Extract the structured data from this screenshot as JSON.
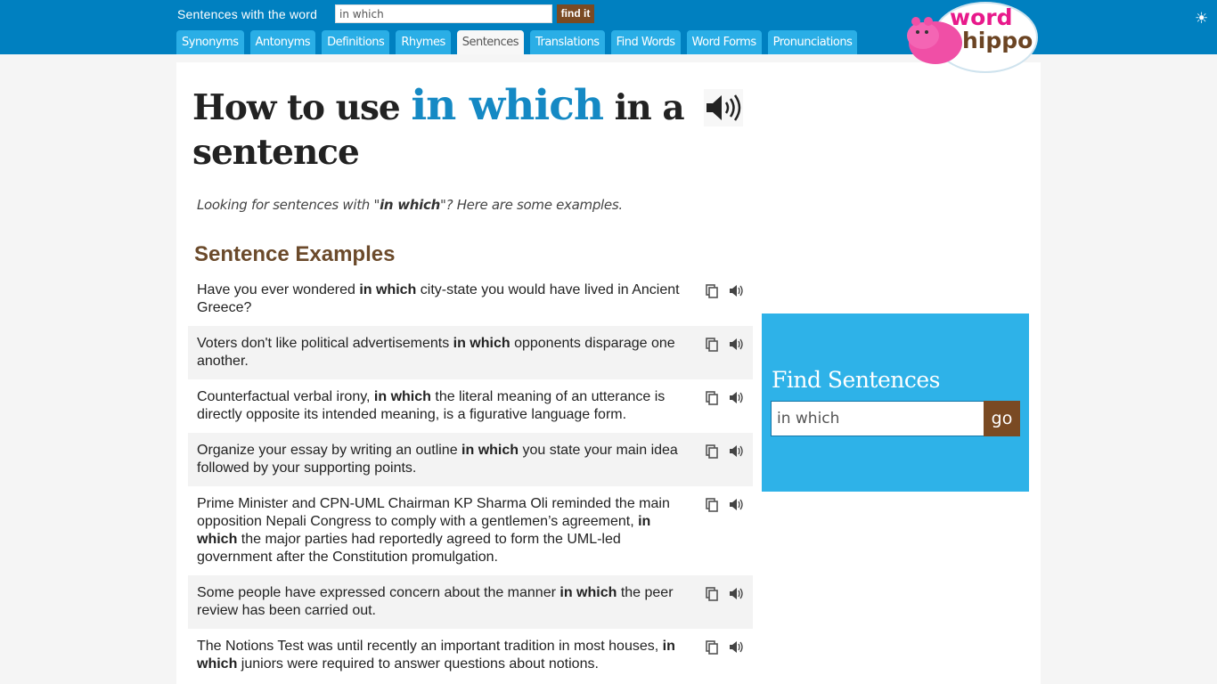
{
  "header": {
    "search_label": "Sentences with the word",
    "search_value": "in which",
    "find_label": "find it",
    "tabs": [
      {
        "label": "Synonyms",
        "active": false
      },
      {
        "label": "Antonyms",
        "active": false
      },
      {
        "label": "Definitions",
        "active": false
      },
      {
        "label": "Rhymes",
        "active": false
      },
      {
        "label": "Sentences",
        "active": true
      },
      {
        "label": "Translations",
        "active": false
      },
      {
        "label": "Find Words",
        "active": false
      },
      {
        "label": "Word Forms",
        "active": false
      },
      {
        "label": "Pronunciations",
        "active": false
      }
    ],
    "logo_word": "word",
    "logo_hippo": "hippo",
    "theme_icon": "☀"
  },
  "main": {
    "title_before": "How to use ",
    "title_word": "in which",
    "title_after": " in a sentence",
    "intro_before": "Looking for sentences with \"",
    "intro_word": "in which",
    "intro_after": "\"? Here are some examples.",
    "section_title": "Sentence Examples",
    "sentences": [
      {
        "before": "Have you ever wondered ",
        "word": "in which",
        "after": " city-state you would have lived in Ancient Greece?"
      },
      {
        "before": "Voters don't like political advertisements ",
        "word": "in which",
        "after": " opponents disparage one another."
      },
      {
        "before": "Counterfactual verbal irony, ",
        "word": "in which",
        "after": " the literal meaning of an utterance is directly opposite its intended meaning, is a figurative language form."
      },
      {
        "before": "Organize your essay by writing an outline ",
        "word": "in which",
        "after": " you state your main idea followed by your supporting points."
      },
      {
        "before": "Prime Minister and CPN-UML Chairman KP Sharma Oli reminded the main opposition Nepali Congress to comply with a gentlemen’s agreement, ",
        "word": "in which",
        "after": " the major parties had reportedly agreed to form the UML-led government after the Constitution promulgation."
      },
      {
        "before": "Some people have expressed concern about the manner ",
        "word": "in which",
        "after": " the peer review has been carried out."
      },
      {
        "before": "The Notions Test was until recently an important tradition in most houses, ",
        "word": "in which",
        "after": " juniors were required to answer questions about notions."
      }
    ]
  },
  "sidebar": {
    "title": "Find Sentences",
    "search_value": "in which",
    "go_label": "go"
  },
  "colors": {
    "header_bg": "#0080c0",
    "tab_bg": "#2aaee6",
    "accent_brown": "#7a4a23",
    "highlight_blue": "#1589c4",
    "side_panel_bg": "#2eb2e8"
  }
}
